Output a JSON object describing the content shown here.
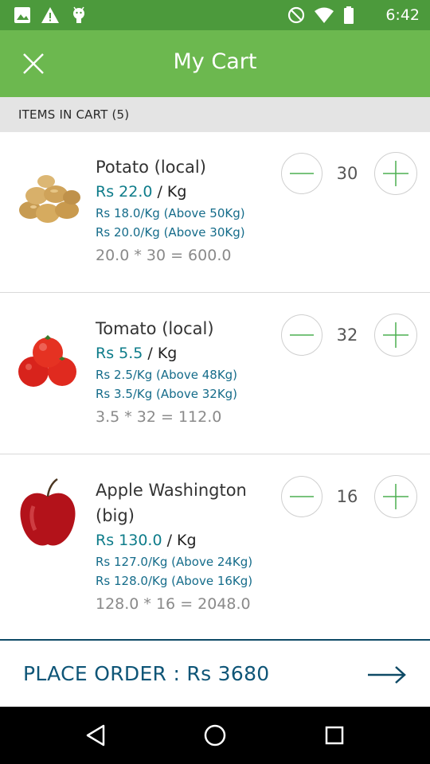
{
  "status_bar": {
    "time": "6:42",
    "icons": [
      "image-notification-icon",
      "warning-icon",
      "android-icon",
      "do-not-disturb-icon",
      "wifi-icon",
      "battery-icon"
    ]
  },
  "app_bar": {
    "title": "My Cart",
    "close_icon": "close-icon"
  },
  "items_header": "ITEMS IN CART (5)",
  "items": [
    {
      "name": "Potato (local)",
      "price": "Rs 22.0",
      "unit": " / Kg",
      "tiers": [
        "Rs 18.0/Kg (Above 50Kg)",
        "Rs 20.0/Kg (Above 30Kg)"
      ],
      "calc": "20.0 * 30 = 600.0",
      "qty": "30",
      "image": "potato-image"
    },
    {
      "name": "Tomato (local)",
      "price": "Rs 5.5",
      "unit": " / Kg",
      "tiers": [
        "Rs 2.5/Kg (Above 48Kg)",
        "Rs 3.5/Kg (Above 32Kg)"
      ],
      "calc": "3.5 * 32 = 112.0",
      "qty": "32",
      "image": "tomato-image"
    },
    {
      "name": "Apple Washington (big)",
      "price": "Rs 130.0",
      "unit": " / Kg",
      "tiers": [
        "Rs 127.0/Kg (Above 24Kg)",
        "Rs 128.0/Kg (Above 16Kg)"
      ],
      "calc": "128.0 * 16 = 2048.0",
      "qty": "16",
      "image": "apple-image"
    }
  ],
  "order_bar": {
    "label": "PLACE ORDER : Rs 3680",
    "icon": "arrow-right-icon"
  },
  "nav_bar": {
    "icons": [
      "back-triangle-icon",
      "home-circle-icon",
      "recents-square-icon"
    ]
  },
  "colors": {
    "status_bar": "#4c9a3c",
    "app_bar": "#6cb84f",
    "price": "#0e7c8a",
    "tier": "#156c8a",
    "order_text": "#0e5577",
    "qty_icon": "#4caf50"
  }
}
